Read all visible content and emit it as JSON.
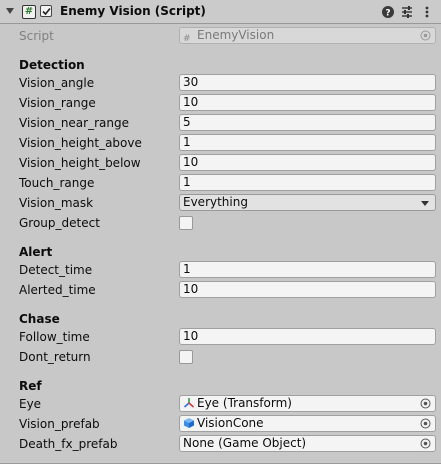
{
  "header": {
    "title": "Enemy Vision (Script)"
  },
  "script_row": {
    "label": "Script",
    "value": "EnemyVision"
  },
  "sections": {
    "detection": {
      "title": "Detection",
      "vision_angle": {
        "label": "Vision_angle",
        "value": "30"
      },
      "vision_range": {
        "label": "Vision_range",
        "value": "10"
      },
      "vision_near_range": {
        "label": "Vision_near_range",
        "value": "5"
      },
      "vision_height_above": {
        "label": "Vision_height_above",
        "value": "1"
      },
      "vision_height_below": {
        "label": "Vision_height_below",
        "value": "10"
      },
      "touch_range": {
        "label": "Touch_range",
        "value": "1"
      },
      "vision_mask": {
        "label": "Vision_mask",
        "value": "Everything"
      },
      "group_detect": {
        "label": "Group_detect",
        "checked": false
      }
    },
    "alert": {
      "title": "Alert",
      "detect_time": {
        "label": "Detect_time",
        "value": "1"
      },
      "alerted_time": {
        "label": "Alerted_time",
        "value": "10"
      }
    },
    "chase": {
      "title": "Chase",
      "follow_time": {
        "label": "Follow_time",
        "value": "10"
      },
      "dont_return": {
        "label": "Dont_return",
        "checked": false
      }
    },
    "ref": {
      "title": "Ref",
      "eye": {
        "label": "Eye",
        "value": "Eye (Transform)",
        "icon": "transform-icon"
      },
      "vision_prefab": {
        "label": "Vision_prefab",
        "value": "VisionCone",
        "icon": "prefab-cube-icon"
      },
      "death_fx_prefab": {
        "label": "Death_fx_prefab",
        "value": "None (Game Object)"
      }
    }
  },
  "colors": {
    "background": "#c8c8c8",
    "field_bg": "#f4f4f4",
    "prefab_blue": "#3b8ee8"
  }
}
